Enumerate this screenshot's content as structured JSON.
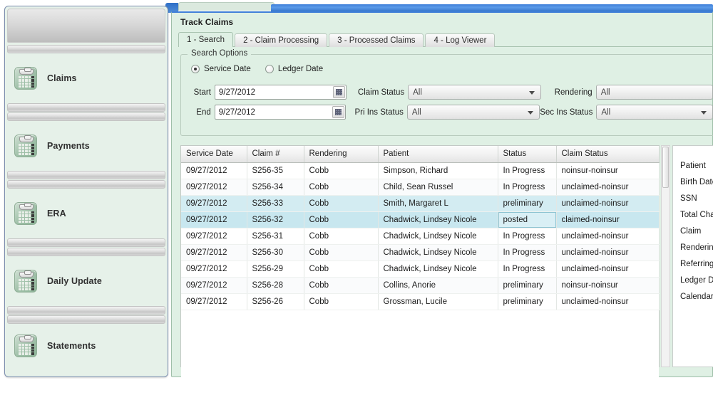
{
  "window": {
    "title_bar_color": "#3f7fd8",
    "panel_bg": "#dff0e4"
  },
  "sidebar": {
    "items": [
      {
        "label": "Claims",
        "icon": "calendar-clipboard-icon"
      },
      {
        "label": "Payments",
        "icon": "calendar-clipboard-icon"
      },
      {
        "label": "ERA",
        "icon": "calendar-clipboard-icon"
      },
      {
        "label": "Daily Update",
        "icon": "calendar-clipboard-icon"
      },
      {
        "label": "Statements",
        "icon": "calendar-clipboard-icon"
      }
    ]
  },
  "main": {
    "title": "Track Claims",
    "tabs": [
      {
        "label": "1 - Search",
        "active": true
      },
      {
        "label": "2 - Claim Processing",
        "active": false
      },
      {
        "label": "3 - Processed Claims",
        "active": false
      },
      {
        "label": "4 - Log Viewer",
        "active": false
      }
    ]
  },
  "search_options": {
    "legend": "Search Options",
    "radios": [
      {
        "label": "Service Date",
        "selected": true
      },
      {
        "label": "Ledger Date",
        "selected": false
      }
    ],
    "start": {
      "label": "Start",
      "value": "9/27/2012",
      "button_icon": "calendar-icon"
    },
    "end": {
      "label": "End",
      "value": "9/27/2012",
      "button_icon": "calendar-icon"
    },
    "claim_status": {
      "label": "Claim Status",
      "value": "All"
    },
    "pri_ins_status": {
      "label": "Pri Ins Status",
      "value": "All"
    },
    "rendering": {
      "label": "Rendering",
      "value": "All"
    },
    "sec_ins_status": {
      "label": "Sec Ins Status",
      "value": "All"
    }
  },
  "grid": {
    "columns": [
      "Service Date",
      "Claim #",
      "Rendering",
      "Patient",
      "Status",
      "Claim Status"
    ],
    "rows": [
      {
        "service_date": "09/27/2012",
        "claim": "S256-35",
        "rendering": "Cobb",
        "patient": "Simpson, Richard",
        "status": "In Progress",
        "claim_status": "noinsur-noinsur",
        "state": "normal"
      },
      {
        "service_date": "09/27/2012",
        "claim": "S256-34",
        "rendering": "Cobb",
        "patient": "Child, Sean Russel",
        "status": "In Progress",
        "claim_status": "unclaimed-noinsur",
        "state": "alt"
      },
      {
        "service_date": "09/27/2012",
        "claim": "S256-33",
        "rendering": "Cobb",
        "patient": "Smith, Margaret L",
        "status": "preliminary",
        "claim_status": "unclaimed-noinsur",
        "state": "sel"
      },
      {
        "service_date": "09/27/2012",
        "claim": "S256-32",
        "rendering": "Cobb",
        "patient": "Chadwick, Lindsey Nicole",
        "status": "posted",
        "claim_status": "claimed-noinsur",
        "state": "sel2"
      },
      {
        "service_date": "09/27/2012",
        "claim": "S256-31",
        "rendering": "Cobb",
        "patient": "Chadwick, Lindsey Nicole",
        "status": "In Progress",
        "claim_status": "unclaimed-noinsur",
        "state": "normal"
      },
      {
        "service_date": "09/27/2012",
        "claim": "S256-30",
        "rendering": "Cobb",
        "patient": "Chadwick, Lindsey Nicole",
        "status": "In Progress",
        "claim_status": "unclaimed-noinsur",
        "state": "alt"
      },
      {
        "service_date": "09/27/2012",
        "claim": "S256-29",
        "rendering": "Cobb",
        "patient": "Chadwick, Lindsey Nicole",
        "status": "In Progress",
        "claim_status": "unclaimed-noinsur",
        "state": "normal"
      },
      {
        "service_date": "09/27/2012",
        "claim": "S256-28",
        "rendering": "Cobb",
        "patient": "Collins, Anorie",
        "status": "preliminary",
        "claim_status": "noinsur-noinsur",
        "state": "alt"
      },
      {
        "service_date": "09/27/2012",
        "claim": "S256-26",
        "rendering": "Cobb",
        "patient": "Grossman, Lucile",
        "status": "preliminary",
        "claim_status": "unclaimed-noinsur",
        "state": "normal"
      }
    ]
  },
  "detail_panel": {
    "labels": [
      "Patient",
      "Birth Date",
      "SSN",
      "Total Charge",
      "Claim",
      "Rendering",
      "Referring",
      "Ledger Date",
      "Calendar"
    ]
  }
}
